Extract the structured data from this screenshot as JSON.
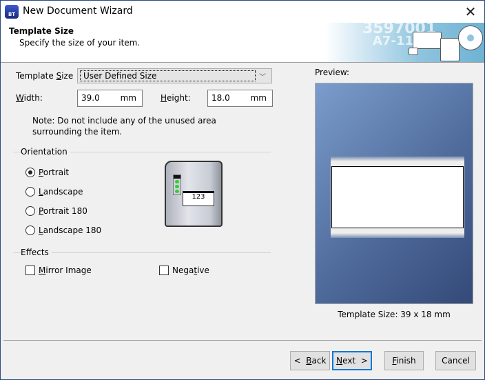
{
  "window": {
    "title": "New Document Wizard",
    "close_glyph": "✕",
    "icon": "bartender-app-icon"
  },
  "header": {
    "title": "Template Size",
    "subtitle": "Specify the size of your item.",
    "banner_text_1": "3597001",
    "banner_text_2": "A7-118"
  },
  "form": {
    "template_size_label_pre": "Template ",
    "template_size_label_key": "S",
    "template_size_label_post": "ize",
    "template_size_value": "User Defined Size",
    "width_label_key": "W",
    "width_label_post": "idth:",
    "width_value": "39.0",
    "width_unit": "mm",
    "height_label_key": "H",
    "height_label_post": "eight:",
    "height_value": "18.0",
    "height_unit": "mm",
    "note": "Note: Do not include any of the unused area surrounding the item."
  },
  "orientation": {
    "label": "Orientation",
    "selected": "Portrait",
    "options": [
      {
        "key": "P",
        "rest": "ortrait"
      },
      {
        "key": "L",
        "rest": "andscape"
      },
      {
        "key": "P",
        "rest": "ortrait 180"
      },
      {
        "key": "L",
        "rest": "andscape 180"
      }
    ]
  },
  "printer_label_text": "123",
  "effects": {
    "label": "Effects",
    "mirror_pre": "",
    "mirror_key": "M",
    "mirror_post": "irror Image",
    "mirror_checked": false,
    "negative_pre": "Nega",
    "negative_key": "t",
    "negative_post": "ive",
    "negative_checked": false
  },
  "preview": {
    "label": "Preview:",
    "size_text": "Template Size:  39 x 18 mm"
  },
  "buttons": {
    "back_pre": "<  ",
    "back_key": "B",
    "back_post": "ack",
    "next_key": "N",
    "next_post": "ext  >",
    "finish_key": "F",
    "finish_post": "inish",
    "cancel": "Cancel"
  }
}
